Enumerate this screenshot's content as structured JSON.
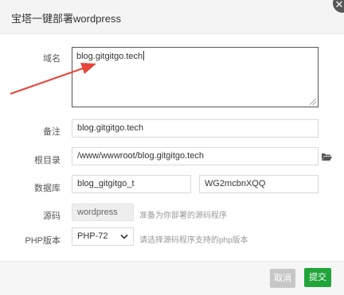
{
  "dialog": {
    "title": "宝塔一键部署wordpress",
    "close_symbol": "✕"
  },
  "form": {
    "domain": {
      "label": "域名",
      "value": "blog.gitgitgo.tech"
    },
    "remark": {
      "label": "备注",
      "value": "blog.gitgitgo.tech"
    },
    "root_dir": {
      "label": "根目录",
      "value": "/www/wwwroot/blog.gitgitgo.tech"
    },
    "database": {
      "label": "数据库",
      "name": "blog_gitgitgo_t",
      "password": "WG2mcbnXQQ"
    },
    "source": {
      "label": "源码",
      "value": "wordpress",
      "hint": "准备为你部署的源码程序"
    },
    "php": {
      "label": "PHP版本",
      "selected": "PHP-72",
      "hint": "请选择源码程序支持的php版本"
    }
  },
  "footer": {
    "cancel_label": "取消",
    "submit_label": "提交"
  },
  "colors": {
    "submit": "#20a53a",
    "cancel": "#c7c7c7",
    "annotation_arrow": "#e8453c",
    "folder_icon": "#555555"
  },
  "icons": {
    "close": "close-icon",
    "folder": "folder-icon",
    "select_arrow": "chevron-down-icon",
    "resize": "resize-grip-icon"
  }
}
